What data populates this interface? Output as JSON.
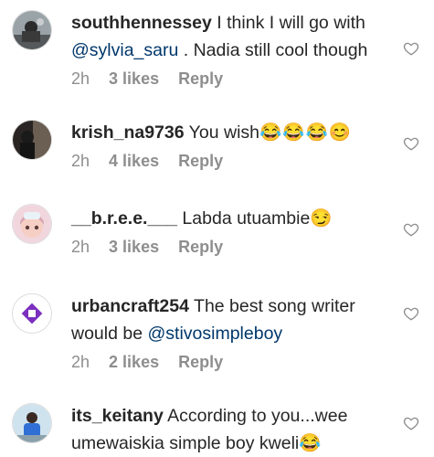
{
  "comments": [
    {
      "username": "southhennessey",
      "text_before": " I think I will go with ",
      "mention": "@sylvia_saru",
      "text_after": " . Nadia still cool though",
      "emoji": "",
      "time": "2h",
      "likes": "3 likes",
      "reply": "Reply"
    },
    {
      "username": "krish_na9736",
      "text_before": " You wish",
      "mention": "",
      "text_after": "",
      "emoji": "😂😂😂😊",
      "time": "2h",
      "likes": "4 likes",
      "reply": "Reply"
    },
    {
      "username": "__b.r.e.e.___",
      "text_before": " Labda utuambie",
      "mention": "",
      "text_after": "",
      "emoji": "😏",
      "time": "2h",
      "likes": "3 likes",
      "reply": "Reply"
    },
    {
      "username": "urbancraft254",
      "text_before": " The best song writer would be ",
      "mention": "@stivosimpleboy",
      "text_after": "",
      "emoji": "",
      "time": "2h",
      "likes": "2 likes",
      "reply": "Reply"
    },
    {
      "username": "its_keitany",
      "text_before": " According to you...wee umewaiskia simple boy kweli",
      "mention": "",
      "text_after": "",
      "emoji": "😂",
      "time": "",
      "likes": "",
      "reply": ""
    }
  ],
  "colors": {
    "mention": "#00376b",
    "meta": "#8e8e8e",
    "heart": "#8e8e8e"
  },
  "icons": {
    "like": "heart-outline-icon"
  }
}
